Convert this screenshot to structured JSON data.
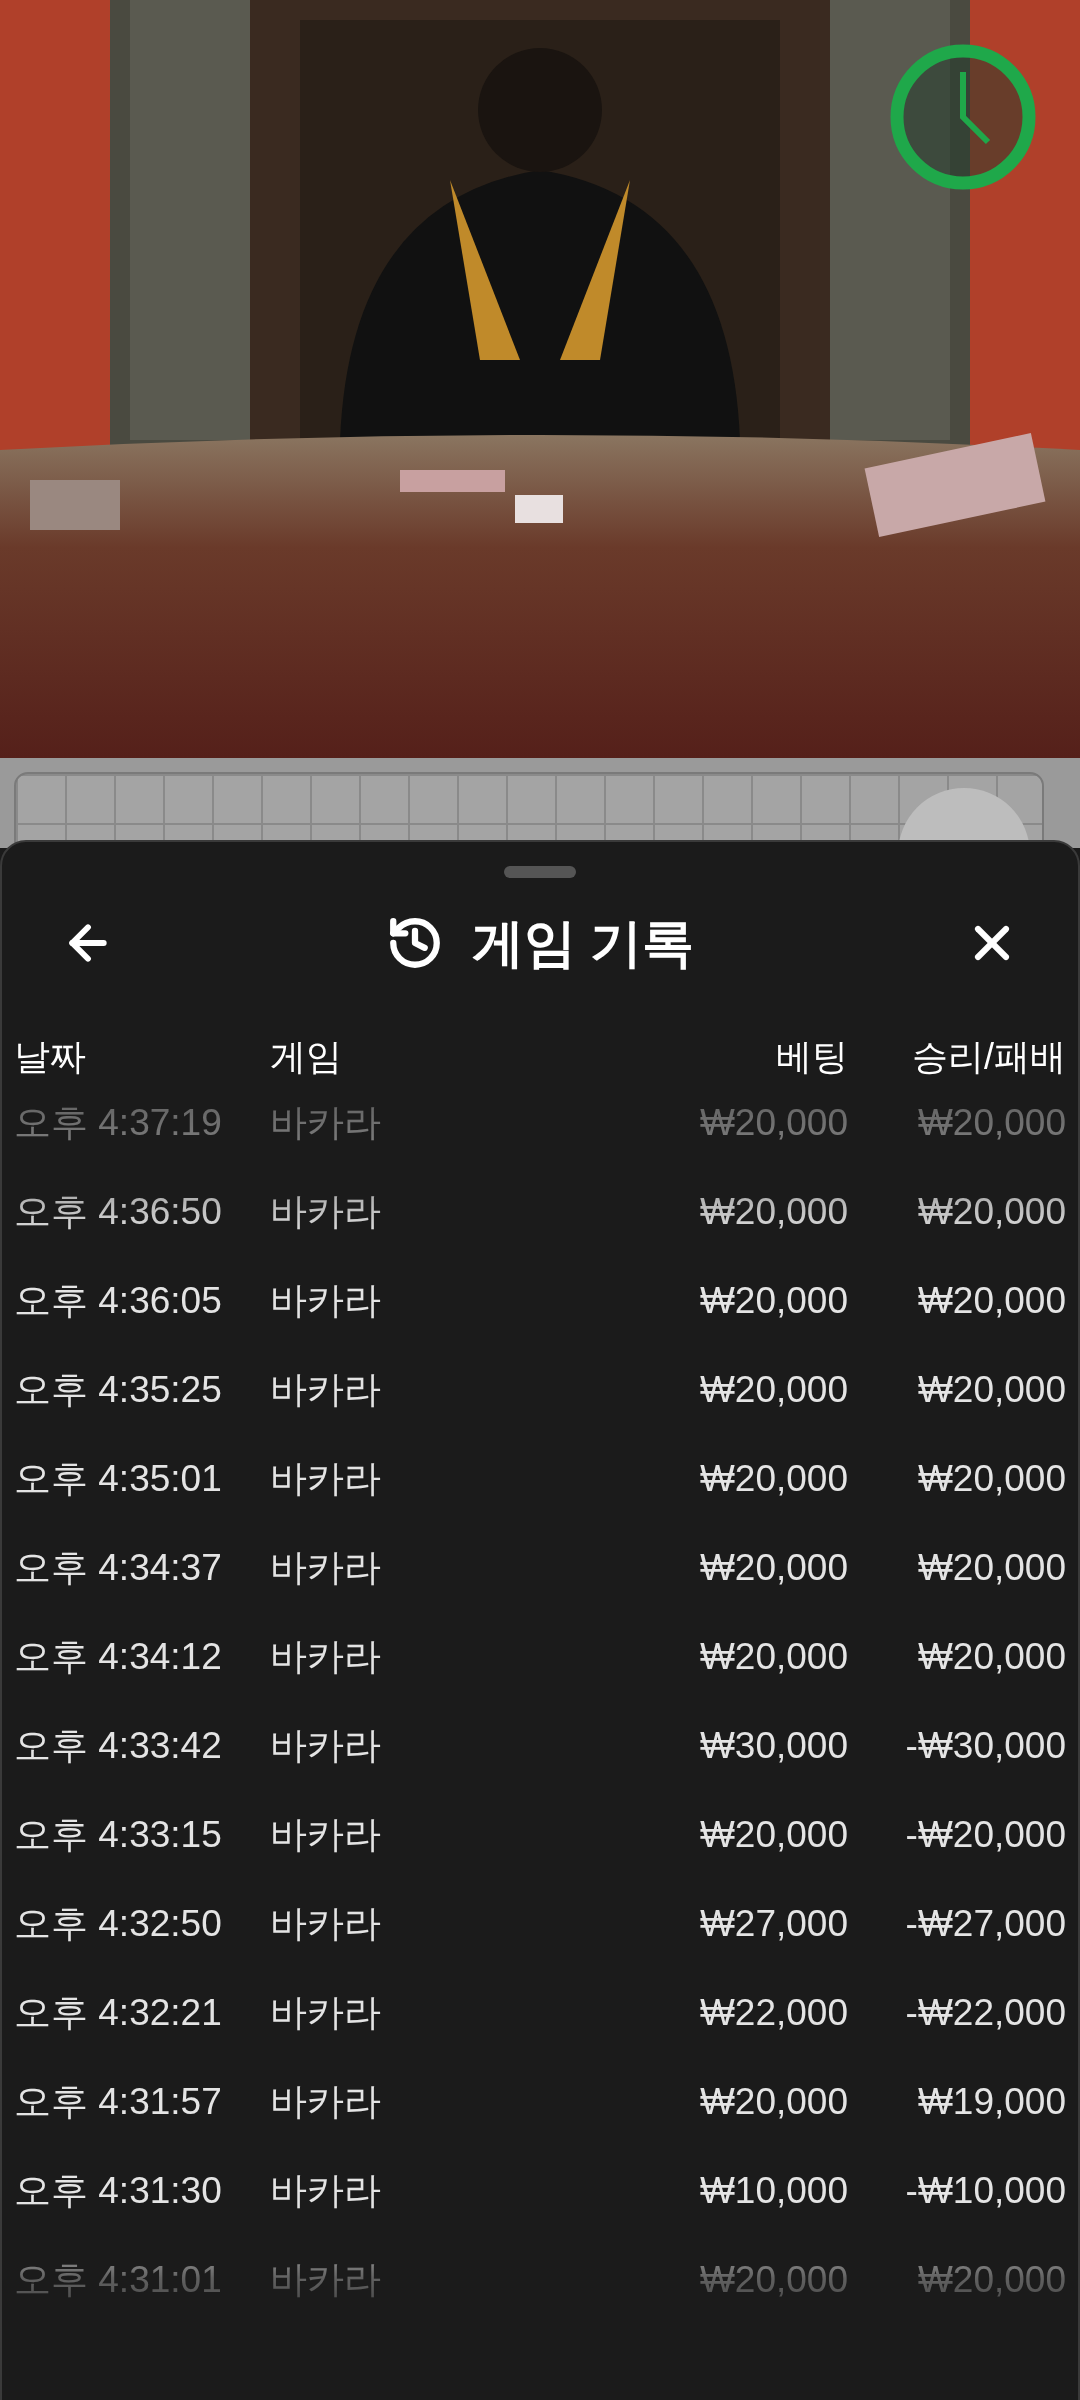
{
  "sheet": {
    "title": "게임 기록"
  },
  "table": {
    "columns": [
      "날짜",
      "게임",
      "베팅",
      "승리/패배"
    ],
    "rows": [
      {
        "date": "오후 4:37:19",
        "game": "바카라",
        "bet": "₩20,000",
        "result": "₩20,000"
      },
      {
        "date": "오후 4:36:50",
        "game": "바카라",
        "bet": "₩20,000",
        "result": "₩20,000"
      },
      {
        "date": "오후 4:36:05",
        "game": "바카라",
        "bet": "₩20,000",
        "result": "₩20,000"
      },
      {
        "date": "오후 4:35:25",
        "game": "바카라",
        "bet": "₩20,000",
        "result": "₩20,000"
      },
      {
        "date": "오후 4:35:01",
        "game": "바카라",
        "bet": "₩20,000",
        "result": "₩20,000"
      },
      {
        "date": "오후 4:34:37",
        "game": "바카라",
        "bet": "₩20,000",
        "result": "₩20,000"
      },
      {
        "date": "오후 4:34:12",
        "game": "바카라",
        "bet": "₩20,000",
        "result": "₩20,000"
      },
      {
        "date": "오후 4:33:42",
        "game": "바카라",
        "bet": "₩30,000",
        "result": "-₩30,000"
      },
      {
        "date": "오후 4:33:15",
        "game": "바카라",
        "bet": "₩20,000",
        "result": "-₩20,000"
      },
      {
        "date": "오후 4:32:50",
        "game": "바카라",
        "bet": "₩27,000",
        "result": "-₩27,000"
      },
      {
        "date": "오후 4:32:21",
        "game": "바카라",
        "bet": "₩22,000",
        "result": "-₩22,000"
      },
      {
        "date": "오후 4:31:57",
        "game": "바카라",
        "bet": "₩20,000",
        "result": "₩19,000"
      },
      {
        "date": "오후 4:31:30",
        "game": "바카라",
        "bet": "₩10,000",
        "result": "-₩10,000"
      },
      {
        "date": "오후 4:31:01",
        "game": "바카라",
        "bet": "₩20,000",
        "result": "₩20,000"
      }
    ]
  }
}
